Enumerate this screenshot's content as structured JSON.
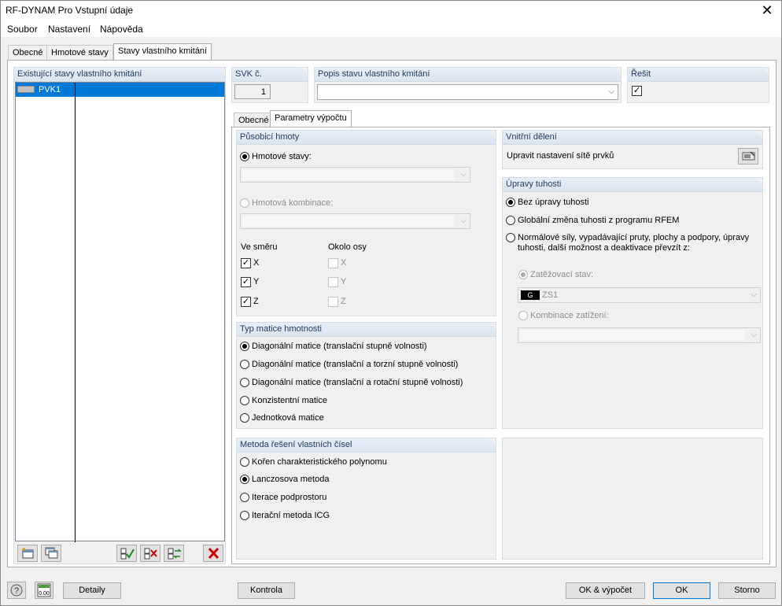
{
  "window": {
    "title": "RF-DYNAM Pro Vstupní údaje"
  },
  "menu": {
    "items": [
      "Soubor",
      "Nastavení",
      "Nápověda"
    ]
  },
  "main_tabs": [
    "Obecné",
    "Hmotové stavy",
    "Stavy vlastního kmitání"
  ],
  "left_panel": {
    "header": "Existující stavy vlastního kmitání",
    "items": [
      {
        "name": "PVK1"
      }
    ]
  },
  "svk": {
    "label": "SVK č.",
    "value": "1"
  },
  "popis": {
    "label": "Popis stavu vlastního kmitání",
    "value": ""
  },
  "resit": {
    "label": "Řešit",
    "checked": true
  },
  "sub_tabs": [
    "Obecné",
    "Parametry výpočtu"
  ],
  "pusobici_hmoty": {
    "header": "Působicí hmoty",
    "hmotove_stavy": "Hmotové stavy:",
    "hmotova_kombinace": "Hmotová kombinace:",
    "ve_smeru": "Ve směru",
    "okolo_osy": "Okolo osy",
    "axes": [
      "X",
      "Y",
      "Z"
    ]
  },
  "typ_matice": {
    "header": "Typ matice hmotnosti",
    "options": [
      "Diagonální matice (translační stupně volnosti)",
      "Diagonální matice (translační a torzní stupně volnosti)",
      "Diagonální matice (translační a rotační stupně volnosti)",
      "Konzistentní matice",
      "Jednotková matice"
    ],
    "selected_index": 0
  },
  "metoda": {
    "header": "Metoda řešení vlastních čísel",
    "options": [
      "Kořen charakteristického polynomu",
      "Lanczosova metoda",
      "Iterace podprostoru",
      "Iterační metoda ICG"
    ],
    "selected_index": 1
  },
  "vnitrni_deleni": {
    "header": "Vnitřní dělení",
    "label": "Upravit nastavení sítě prvků"
  },
  "upravy_tuhosti": {
    "header": "Úpravy tuhosti",
    "options": [
      "Bez úpravy tuhosti",
      "Globální změna tuhosti z programu RFEM",
      "Normálové síly, vypadávající pruty, plochy a podpory, úpravy",
      "tuhosti, další možnost a deaktivace převzít z:"
    ],
    "zatezovaci_stav": "Zatěžovací stav:",
    "ls_tag": "G",
    "ls_value": "ZS1",
    "kombinace_zatizeni": "Kombinace zatížení:"
  },
  "footer": {
    "detaily": "Detaily",
    "kontrola": "Kontrola",
    "ok_vypocet": "OK & výpočet",
    "ok": "OK",
    "storno": "Storno",
    "calc_icon_text": "0.00"
  }
}
